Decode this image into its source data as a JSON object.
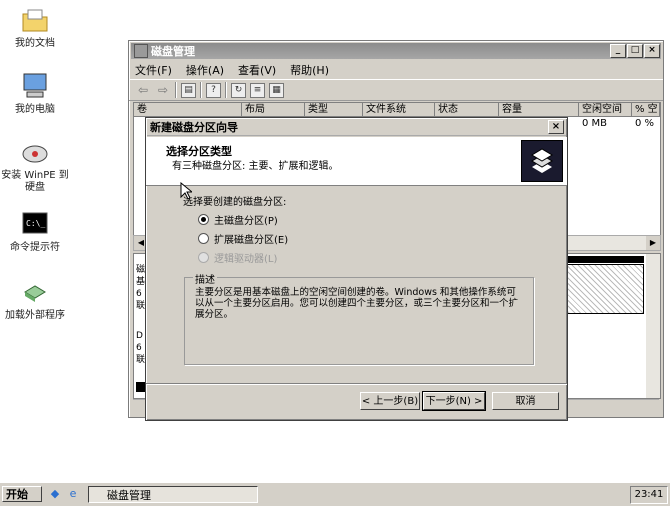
{
  "desktop": {
    "icons": [
      {
        "label": "我的文档",
        "icon": "folder-documents-icon"
      },
      {
        "label": "我的电脑",
        "icon": "my-computer-icon"
      },
      {
        "label": "安装 WinPE 到 硬盘",
        "icon": "install-disk-icon"
      },
      {
        "label": "命令提示符",
        "icon": "command-prompt-icon"
      },
      {
        "label": "加载外部程序",
        "icon": "load-program-icon"
      }
    ]
  },
  "window": {
    "title": "磁盘管理",
    "menu": [
      "文件(F)",
      "操作(A)",
      "查看(V)",
      "帮助(H)"
    ],
    "columns": [
      "卷",
      "布局",
      "类型",
      "文件系统",
      "状态",
      "容量",
      "空闲空间",
      "% 空"
    ],
    "rows": [
      {
        "free": "0 MB",
        "pct": "0 %"
      }
    ],
    "lower_left_fragments": [
      "磁",
      "基",
      "6",
      "联",
      "D",
      "6",
      "联"
    ]
  },
  "dialog": {
    "title": "新建磁盘分区向导",
    "header_title": "选择分区类型",
    "header_subtitle": "有三种磁盘分区: 主要、扩展和逻辑。",
    "prompt": "选择要创建的磁盘分区:",
    "options": [
      {
        "label": "主磁盘分区(P)",
        "selected": true,
        "enabled": true
      },
      {
        "label": "扩展磁盘分区(E)",
        "selected": false,
        "enabled": true
      },
      {
        "label": "逻辑驱动器(L)",
        "selected": false,
        "enabled": false
      }
    ],
    "group_label": "描述",
    "description": "主要分区是用基本磁盘上的空闲空间创建的卷。Windows 和其他操作系统可以从一个主要分区启用。您可以创建四个主要分区，或三个主要分区和一个扩展分区。",
    "buttons": {
      "back": "< 上一步(B)",
      "next": "下一步(N) >",
      "cancel": "取消"
    }
  },
  "taskbar": {
    "start": "开始",
    "task_label": "磁盘管理",
    "clock": "23:41"
  }
}
